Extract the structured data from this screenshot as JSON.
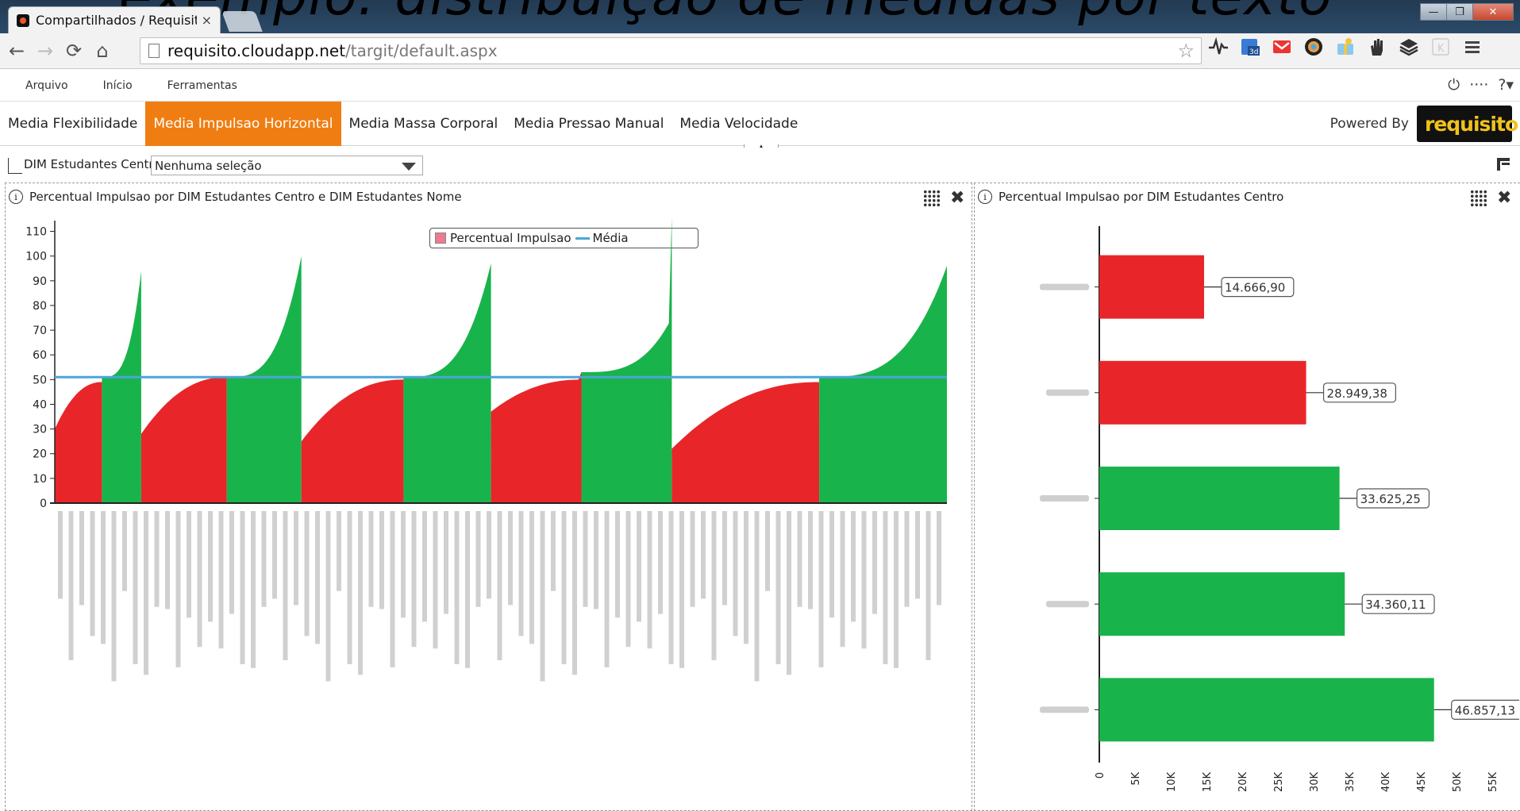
{
  "overlay_text": "exemplo: distribuição de medidas por texto",
  "browser": {
    "tab_title": "Compartilhados / Requisit",
    "tab_close": "×",
    "url_host": "requisito.cloudapp.net",
    "url_path": "/targit/default.aspx",
    "win_min": "—",
    "win_max": "❐",
    "win_close": "✕"
  },
  "menu": {
    "items": [
      "Arquivo",
      "Início",
      "Ferramentas"
    ],
    "power_icon": "⏻",
    "dots": "····",
    "help_icon": "?▾"
  },
  "dash_tabs": [
    {
      "label": "Media Flexibilidade",
      "active": false
    },
    {
      "label": "Media Impulsao Horizontal",
      "active": true
    },
    {
      "label": "Media Massa Corporal",
      "active": false
    },
    {
      "label": "Media Pressao Manual",
      "active": false
    },
    {
      "label": "Media Velocidade",
      "active": false
    }
  ],
  "powered_by": "Powered By",
  "logo_text": "requisito",
  "filter": {
    "label": "DIM Estudantes Centro",
    "value": "Nenhuma seleção"
  },
  "left_panel": {
    "title": "Percentual Impulsao por DIM Estudantes Centro e DIM Estudantes Nome",
    "legend_series": "Percentual Impulsao",
    "legend_avg": "Média"
  },
  "right_panel": {
    "title": "Percentual Impulsao por DIM Estudantes Centro"
  },
  "colors": {
    "red": "#e8262a",
    "green": "#19b34b",
    "avg_line": "#4aa6d8",
    "active_tab": "#f07d11"
  },
  "chart_data": [
    {
      "type": "area",
      "title": "Percentual Impulsao por DIM Estudantes Centro e DIM Estudantes Nome",
      "ylim": [
        0,
        115
      ],
      "yticks": [
        0,
        10,
        20,
        30,
        40,
        50,
        60,
        70,
        80,
        90,
        100,
        110
      ],
      "average": 51,
      "segments": [
        {
          "color": "red",
          "start": 30,
          "end": 49,
          "peak": 49
        },
        {
          "color": "green",
          "start": 51,
          "end": 94,
          "peak": 94
        },
        {
          "color": "red",
          "start": 28,
          "end": 51,
          "peak": 51
        },
        {
          "color": "green",
          "start": 51,
          "end": 100,
          "peak": 100
        },
        {
          "color": "red",
          "start": 25,
          "end": 50,
          "peak": 50
        },
        {
          "color": "green",
          "start": 51,
          "end": 97,
          "peak": 97
        },
        {
          "color": "red",
          "start": 37,
          "end": 50,
          "peak": 53
        },
        {
          "color": "green",
          "start": 53,
          "end": 75,
          "peak": 116
        },
        {
          "color": "red",
          "start": 22,
          "end": 49,
          "peak": 49
        },
        {
          "color": "green",
          "start": 51,
          "end": 96,
          "peak": 96
        }
      ],
      "legend": [
        "Percentual Impulsao",
        "Média"
      ]
    },
    {
      "type": "bar",
      "title": "Percentual Impulsao por DIM Estudantes Centro",
      "values": [
        14666.9,
        28949.38,
        33625.25,
        34360.11,
        46857.13
      ],
      "value_labels": [
        "14.666,90",
        "28.949,38",
        "33.625,25",
        "34.360,11",
        "46.857,13"
      ],
      "bar_colors": [
        "red",
        "red",
        "green",
        "green",
        "green"
      ],
      "xlim": [
        0,
        55000
      ],
      "xticks": [
        "0",
        "5K",
        "10K",
        "15K",
        "20K",
        "25K",
        "30K",
        "35K",
        "40K",
        "45K",
        "50K",
        "55K"
      ],
      "xtick_values": [
        0,
        5000,
        10000,
        15000,
        20000,
        25000,
        30000,
        35000,
        40000,
        45000,
        50000,
        55000
      ]
    }
  ]
}
